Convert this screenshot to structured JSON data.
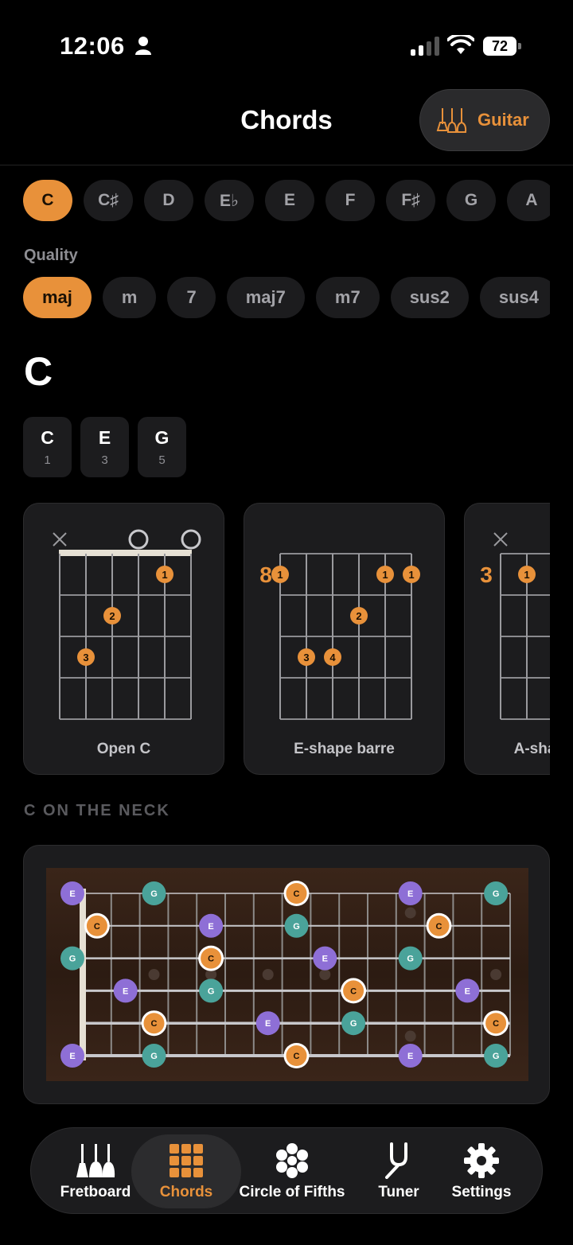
{
  "status": {
    "time": "12:06",
    "battery": "72"
  },
  "header": {
    "title": "Chords",
    "instrument_label": "Guitar"
  },
  "roots": {
    "items": [
      "C",
      "C♯",
      "D",
      "E♭",
      "E",
      "F",
      "F♯",
      "G",
      "A"
    ],
    "selected": "C"
  },
  "quality": {
    "label": "Quality",
    "items": [
      "maj",
      "m",
      "7",
      "maj7",
      "m7",
      "sus2",
      "sus4"
    ],
    "selected": "maj"
  },
  "chord": {
    "name": "C",
    "notes": [
      {
        "note": "C",
        "interval": "1"
      },
      {
        "note": "E",
        "interval": "3"
      },
      {
        "note": "G",
        "interval": "5"
      }
    ]
  },
  "voicings": [
    {
      "label": "Open C",
      "base_fret": "",
      "strings": [
        "x",
        "3",
        "2",
        "0",
        "1",
        "0"
      ],
      "fingers": [
        "",
        "3",
        "2",
        "",
        "1",
        ""
      ]
    },
    {
      "label": "E-shape barre",
      "base_fret": "8",
      "strings": [
        "1",
        "3",
        "3",
        "2",
        "1",
        "1"
      ],
      "fingers": [
        "1",
        "3",
        "4",
        "2",
        "1",
        "1"
      ]
    },
    {
      "label": "A-shape barre",
      "base_fret": "3",
      "strings": [
        "x",
        "1"
      ],
      "fingers": [
        "",
        "1"
      ]
    }
  ],
  "neck": {
    "title": "C ON THE NECK",
    "colors": {
      "root": "#e8913a",
      "third": "#8e6fd6",
      "fifth": "#4aa39a"
    },
    "markers": [
      {
        "s": 0,
        "f": 0,
        "n": "E"
      },
      {
        "s": 0,
        "f": 3,
        "n": "G"
      },
      {
        "s": 0,
        "f": 8,
        "n": "C"
      },
      {
        "s": 0,
        "f": 12,
        "n": "E"
      },
      {
        "s": 0,
        "f": 15,
        "n": "G"
      },
      {
        "s": 1,
        "f": 1,
        "n": "C"
      },
      {
        "s": 1,
        "f": 5,
        "n": "E"
      },
      {
        "s": 1,
        "f": 8,
        "n": "G"
      },
      {
        "s": 1,
        "f": 13,
        "n": "C"
      },
      {
        "s": 2,
        "f": 0,
        "n": "G"
      },
      {
        "s": 2,
        "f": 5,
        "n": "C"
      },
      {
        "s": 2,
        "f": 9,
        "n": "E"
      },
      {
        "s": 2,
        "f": 12,
        "n": "G"
      },
      {
        "s": 3,
        "f": 2,
        "n": "E"
      },
      {
        "s": 3,
        "f": 5,
        "n": "G"
      },
      {
        "s": 3,
        "f": 10,
        "n": "C"
      },
      {
        "s": 3,
        "f": 14,
        "n": "E"
      },
      {
        "s": 4,
        "f": 3,
        "n": "C"
      },
      {
        "s": 4,
        "f": 7,
        "n": "E"
      },
      {
        "s": 4,
        "f": 10,
        "n": "G"
      },
      {
        "s": 4,
        "f": 15,
        "n": "C"
      },
      {
        "s": 5,
        "f": 0,
        "n": "E"
      },
      {
        "s": 5,
        "f": 3,
        "n": "G"
      },
      {
        "s": 5,
        "f": 8,
        "n": "C"
      },
      {
        "s": 5,
        "f": 12,
        "n": "E"
      },
      {
        "s": 5,
        "f": 15,
        "n": "G"
      }
    ]
  },
  "tabs": [
    {
      "label": "Fretboard",
      "icon": "guitars-icon"
    },
    {
      "label": "Chords",
      "icon": "grid-icon"
    },
    {
      "label": "Circle of Fifths",
      "icon": "flower-icon"
    },
    {
      "label": "Tuner",
      "icon": "tuning-fork-icon"
    },
    {
      "label": "Settings",
      "icon": "gear-icon"
    }
  ],
  "active_tab": "Chords"
}
